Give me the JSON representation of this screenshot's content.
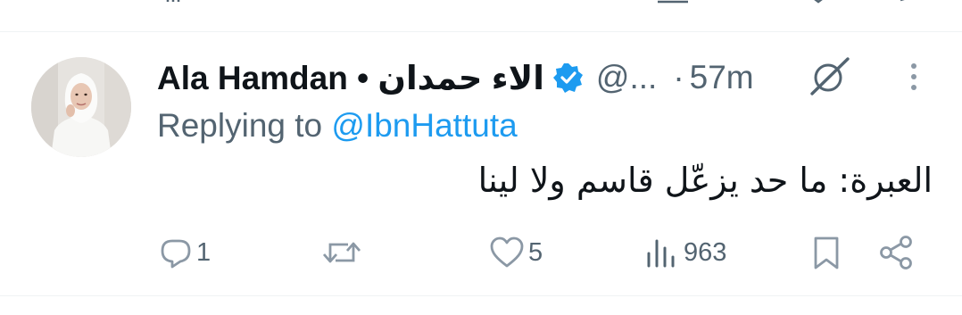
{
  "previous_tweet_actions": [
    {
      "icon": "views-icon"
    },
    {
      "icon": "bookmark-icon"
    },
    {
      "icon": "share-icon"
    }
  ],
  "tweet": {
    "display_name": "Ala Hamdan • الاء حمدان",
    "handle": "@...",
    "separator": "·",
    "time": "57m",
    "verified": true,
    "reply_prefix": "Replying to",
    "reply_mention": "@IbnHattuta",
    "text": "العبرة: ما حد يزعّل قاسم ولا لينا",
    "actions": {
      "replies": "1",
      "retweets": "",
      "likes": "5",
      "views": "963"
    }
  },
  "colors": {
    "text_primary": "#0f1419",
    "text_secondary": "#536471",
    "accent": "#1d9bf0",
    "divider": "#eff3f4"
  }
}
